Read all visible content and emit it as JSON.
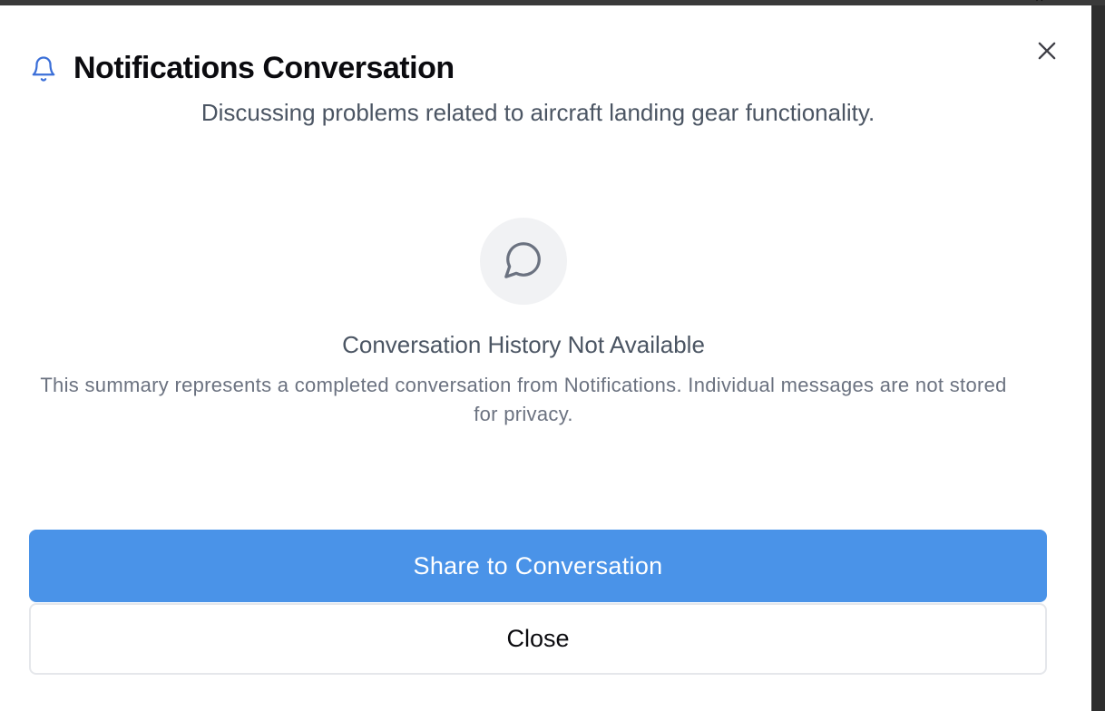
{
  "dialog": {
    "title": "Notifications Conversation",
    "subtitle": "Discussing problems related to aircraft landing gear functionality.",
    "title_icon": "bell-icon",
    "close_icon": "close-icon"
  },
  "empty_state": {
    "icon": "message-circle-icon",
    "title": "Conversation History Not Available",
    "description": "This summary represents a completed conversation from Notifications. Individual messages are not stored for privacy."
  },
  "actions": {
    "share_label": "Share to Conversation",
    "close_label": "Close"
  },
  "colors": {
    "accent": "#4a93e8",
    "bell_icon": "#3b6fd8",
    "muted_text": "#4b5563",
    "icon_circle_bg": "#f1f2f4"
  }
}
